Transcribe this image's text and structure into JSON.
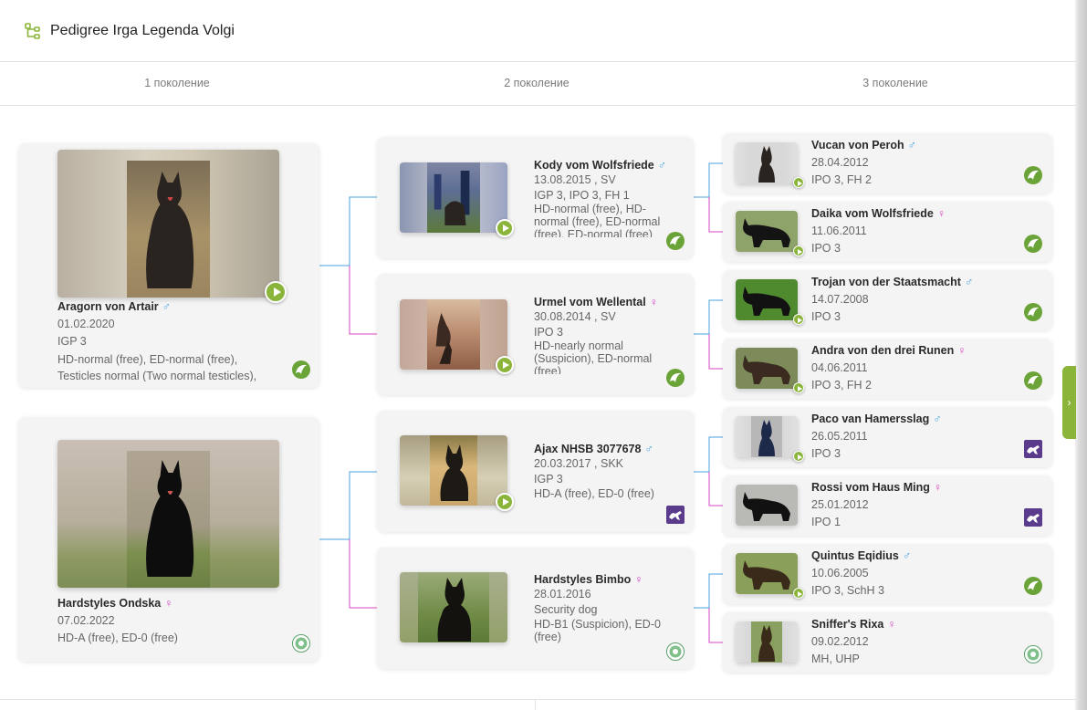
{
  "header": {
    "title": "Pedigree Irga Legenda Volgi",
    "icon": "pedigree-tree-icon"
  },
  "generations": [
    "1 поколение",
    "2 поколение",
    "3 поколение"
  ],
  "colors": {
    "accent": "#8bb53a",
    "male_line": "#4aa3df",
    "female_line": "#d946c4",
    "card_bg": "#f4f4f4"
  },
  "gen1": [
    {
      "name": "Aragorn von Artair",
      "sex": "♂",
      "date": "01.02.2020",
      "titles": "IGP 3",
      "health": "HD-normal (free), ED-normal (free), Testicles normal (Two normal testicles),",
      "org": "sv-leaf-logo",
      "video": true
    },
    {
      "name": "Hardstyles Ondska",
      "sex": "♀",
      "date": "07.02.2022",
      "titles": "HD-A (free), ED-0 (free)",
      "org": "fci-round-logo",
      "video": false
    }
  ],
  "gen2": [
    {
      "name": "Kody vom Wolfsfriede",
      "sex": "♂",
      "date": "13.08.2015 , SV",
      "titles": "IGP 3, IPO 3, FH 1",
      "health": "HD-normal (free), HD-normal (free), ED-normal (free), ED-normal (free)",
      "org": "sv-leaf-logo",
      "video": true
    },
    {
      "name": "Urmel vom Wellental",
      "sex": "♀",
      "date": "30.08.2014 , SV",
      "titles": "IPO 3",
      "health": "HD-nearly normal (Suspicion), ED-normal (free)",
      "org": "sv-leaf-logo",
      "video": true
    },
    {
      "name": "Ajax NHSB 3077678",
      "sex": "♂",
      "date": "20.03.2017 , SKK",
      "titles": "IGP 3",
      "health": "HD-A (free), ED-0 (free)",
      "org": "purple-dog-logo",
      "video": true
    },
    {
      "name": "Hardstyles Bimbo",
      "sex": "♀",
      "date": "28.01.2016",
      "titles": "Security dog",
      "health": "HD-B1 (Suspicion), ED-0 (free)",
      "org": "fci-round-logo",
      "video": false
    }
  ],
  "gen3": [
    {
      "name": "Vucan von Peroh",
      "sex": "♂",
      "date": "28.04.2012",
      "titles": "IPO 3, FH 2",
      "org": "sv-leaf-logo",
      "video": true
    },
    {
      "name": "Daika vom Wolfsfriede",
      "sex": "♀",
      "date": "11.06.2011",
      "titles": "IPO 3",
      "org": "sv-leaf-logo",
      "video": true
    },
    {
      "name": "Trojan von der Staatsmacht",
      "sex": "♂",
      "date": "14.07.2008",
      "titles": "IPO 3",
      "org": "sv-leaf-logo",
      "video": true
    },
    {
      "name": "Andra von den drei Runen",
      "sex": "♀",
      "date": "04.06.2011",
      "titles": "IPO 3, FH 2",
      "org": "sv-leaf-logo",
      "video": true
    },
    {
      "name": "Paco van Hamersslag",
      "sex": "♂",
      "date": "26.05.2011",
      "titles": "IPO 3",
      "org": "purple-dog-logo",
      "video": true
    },
    {
      "name": "Rossi vom Haus Ming",
      "sex": "♀",
      "date": "25.01.2012",
      "titles": "IPO 1",
      "org": "purple-dog-logo",
      "video": false
    },
    {
      "name": "Quintus Eqidius",
      "sex": "♂",
      "date": "10.06.2005",
      "titles": "IPO 3, SchH 3",
      "org": "sv-leaf-logo",
      "video": true
    },
    {
      "name": "Sniffer's Rixa",
      "sex": "♀",
      "date": "09.02.2012",
      "titles": "MH, UHP",
      "org": "fci-round-logo",
      "video": false
    }
  ],
  "side_tab": {
    "label": "›"
  }
}
